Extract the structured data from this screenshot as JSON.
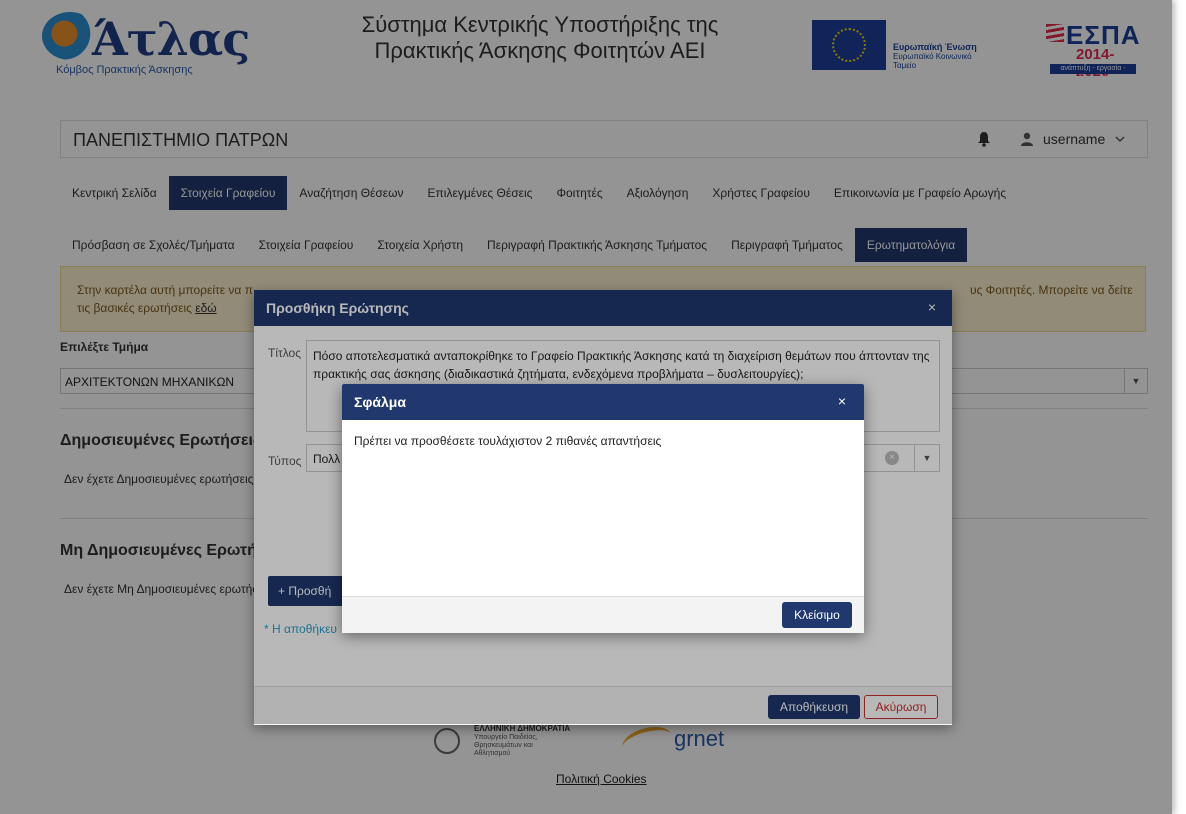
{
  "header": {
    "logo_name": "Άτλας",
    "logo_sub": "Κόμβος Πρακτικής Άσκησης",
    "title_line1": "Σύστημα Κεντρικής Υποστήριξης της",
    "title_line2": "Πρακτικής Άσκησης Φοιτητών ΑΕΙ",
    "eu_name": "Ευρωπαϊκή Ένωση",
    "eu_sub": "Ευρωπαϊκό Κοινωνικό Ταμείο",
    "espa_name": "ΕΣΠΑ",
    "espa_years": "2014-2020",
    "espa_bar": "ανάπτυξη - εργασία - αλληλεγγύη"
  },
  "university": {
    "name": "ΠΑΝΕΠΙΣΤΗΜΙΟ ΠΑΤΡΩΝ",
    "username": "username"
  },
  "nav": {
    "items": [
      {
        "label": "Κεντρική Σελίδα"
      },
      {
        "label": "Στοιχεία Γραφείου"
      },
      {
        "label": "Αναζήτηση Θέσεων"
      },
      {
        "label": "Επιλεγμένες Θέσεις"
      },
      {
        "label": "Φοιτητές"
      },
      {
        "label": "Αξιολόγηση"
      },
      {
        "label": "Χρήστες Γραφείου"
      },
      {
        "label": "Επικοινωνία με Γραφείο Αρωγής"
      }
    ]
  },
  "subnav": {
    "items": [
      {
        "label": "Πρόσβαση σε Σχολές/Τμήματα"
      },
      {
        "label": "Στοιχεία Γραφείου"
      },
      {
        "label": "Στοιχεία Χρήστη"
      },
      {
        "label": "Περιγραφή Πρακτικής Άσκησης Τμήματος"
      },
      {
        "label": "Περιγραφή Τμήματος"
      },
      {
        "label": "Ερωτηματολόγια"
      }
    ]
  },
  "warning": {
    "text_start": "Στην καρτέλα αυτή μπορείτε να π",
    "text_end": "υς Φοιτητές. Μπορείτε να δείτε",
    "text_line2": "τις βασικές ερωτήσεις ",
    "link": "εδώ"
  },
  "department": {
    "label": "Επιλέξτε Τμήμα",
    "value": "ΑΡΧΙΤΕΚΤΟΝΩΝ ΜΗΧΑΝΙΚΩΝ"
  },
  "published": {
    "heading": "Δημοσιευμένες Ερωτήσεις",
    "empty": "Δεν έχετε Δημοσιευμένες ερωτήσεις"
  },
  "unpublished": {
    "heading": "Μη Δημοσιευμένες Ερωτήσεις",
    "empty": "Δεν έχετε Μη Δημοσιευμένες ερωτήσεις"
  },
  "add_modal": {
    "title": "Προσθήκη Ερώτησης",
    "close": "×",
    "title_label": "Τίτλος",
    "title_value": "Πόσο αποτελεσματικά ανταποκρίθηκε το Γραφείο Πρακτικής Άσκησης κατά τη διαχείριση θεμάτων που άπτονταν της πρακτικής σας άσκησης (διαδικαστικά ζητήματα, ενδεχόμενα προβλήματα – δυσλειτουργίες);",
    "type_label": "Τύπος",
    "type_value": "Πολλ",
    "add_answer_label": "+  Προσθή",
    "note": "* Η αποθήκευ",
    "save_label": "Αποθήκευση",
    "cancel_label": "Ακύρωση"
  },
  "error_modal": {
    "title": "Σφάλμα",
    "close": "×",
    "message": "Πρέπει να προσθέσετε τουλάχιστον 2 πιθανές απαντήσεις",
    "close_label": "Κλείσιμο"
  },
  "footer": {
    "gov_name": "ΕΛΛΗΝΙΚΗ ΔΗΜΟΚΡΑΤΙΑ",
    "gov_sub": "Υπουργείο Παιδείας, Θρησκευμάτων και Αθλητισμού",
    "grnet": "grnet",
    "cookies": "Πολιτική Cookies"
  },
  "colors": {
    "primary": "#21386f",
    "warning_bg": "#fcf0cf",
    "danger": "#c9302c",
    "note": "#2aa0c9"
  }
}
